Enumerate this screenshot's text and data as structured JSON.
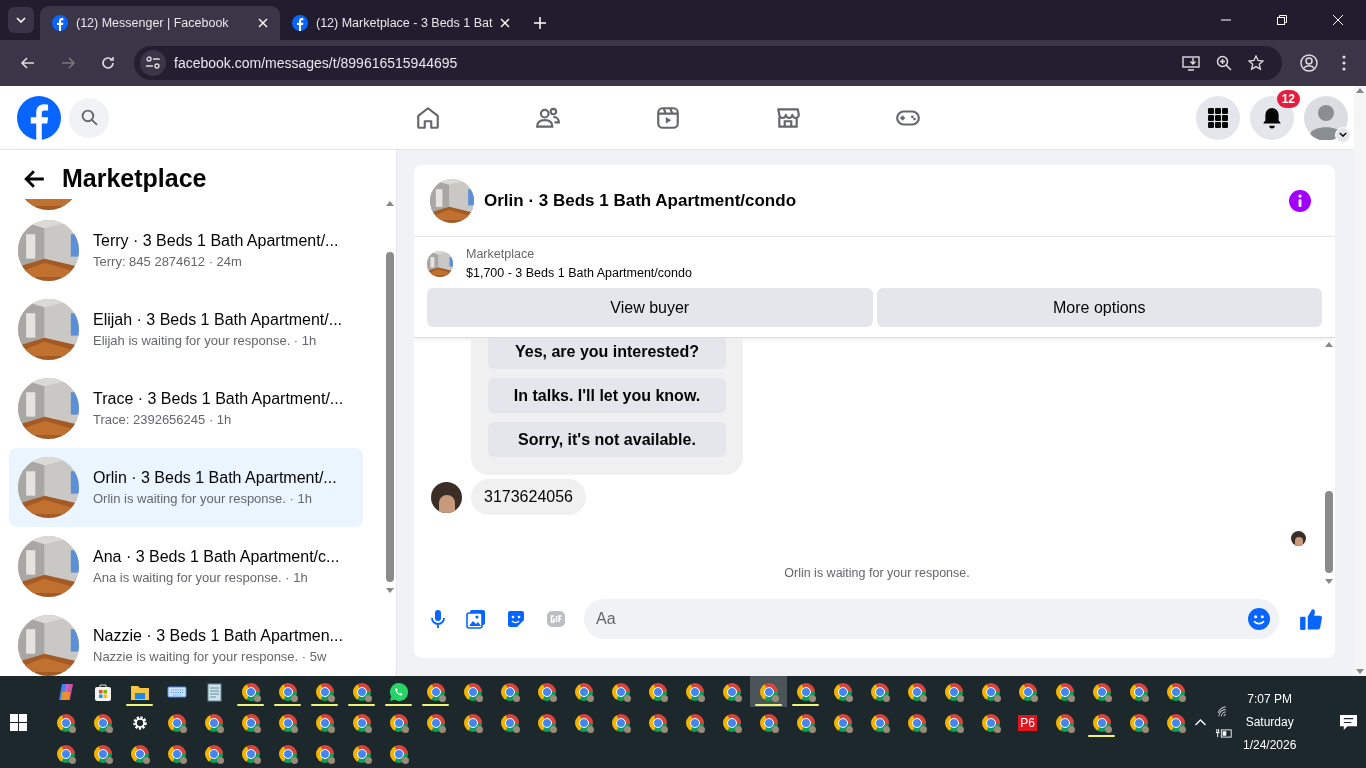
{
  "browser": {
    "tabs": [
      {
        "title": "(12) Messenger | Facebook",
        "selected": true
      },
      {
        "title": "(12) Marketplace - 3 Beds 1 Bat",
        "selected": false
      }
    ],
    "url": "facebook.com/messages/t/899616515944695"
  },
  "header": {
    "notification_count": "12"
  },
  "sidebar": {
    "title": "Marketplace",
    "conversations": [
      {
        "title": "Terry · 3 Beds 1 Bath Apartment/...",
        "subtitle": "Terry: 845 2874612 · 24m",
        "selected": false
      },
      {
        "title": "Elijah · 3 Beds 1 Bath Apartment/...",
        "subtitle": "Elijah is waiting for your response. · 1h",
        "selected": false
      },
      {
        "title": "Trace · 3 Beds 1 Bath Apartment/...",
        "subtitle": "Trace: 2392656245 · 1h",
        "selected": false
      },
      {
        "title": "Orlin · 3 Beds 1 Bath Apartment/...",
        "subtitle": "Orlin is waiting for your response. · 1h",
        "selected": true
      },
      {
        "title": "Ana · 3 Beds 1 Bath Apartment/c...",
        "subtitle": "Ana is waiting for your response. · 1h",
        "selected": false
      },
      {
        "title": "Nazzie · 3 Beds 1 Bath Apartmen...",
        "subtitle": "Nazzie is waiting for your response. · 5w",
        "selected": false
      }
    ]
  },
  "chat": {
    "title": "Orlin · 3 Beds 1 Bath Apartment/condo",
    "listing_label": "Marketplace",
    "listing": "$1,700 - 3 Beds 1 Bath Apartment/condo",
    "buttons": [
      "View buyer",
      "More options"
    ],
    "quick_replies": [
      "Yes, are you interested?",
      "In talks. I'll let you know.",
      "Sorry, it's not available."
    ],
    "message": "3173624056",
    "status": "Orlin is waiting for your response.",
    "composer": {
      "placeholder": "Aa"
    }
  },
  "taskbar": {
    "rows": [
      [
        {
          "kind": "copilot",
          "running": false,
          "selected": false
        },
        {
          "kind": "store",
          "running": false,
          "selected": false
        },
        {
          "kind": "explorer",
          "running": true,
          "selected": false
        },
        {
          "kind": "keyboard",
          "running": false,
          "selected": false
        },
        {
          "kind": "notepad",
          "running": false,
          "selected": false
        },
        {
          "kind": "chrome",
          "running": true,
          "selected": false
        },
        {
          "kind": "chrome",
          "running": true,
          "selected": false
        },
        {
          "kind": "chrome",
          "running": true,
          "selected": false
        },
        {
          "kind": "chrome",
          "running": true,
          "selected": false
        },
        {
          "kind": "whatsapp",
          "running": true,
          "selected": false
        },
        {
          "kind": "chrome",
          "running": true,
          "selected": false
        },
        {
          "kind": "chrome",
          "running": false,
          "selected": false
        },
        {
          "kind": "chrome",
          "running": false,
          "selected": false
        },
        {
          "kind": "chrome",
          "running": false,
          "selected": false
        },
        {
          "kind": "chrome",
          "running": false,
          "selected": false
        },
        {
          "kind": "chrome",
          "running": false,
          "selected": false
        },
        {
          "kind": "chrome",
          "running": false,
          "selected": false
        },
        {
          "kind": "chrome",
          "running": false,
          "selected": false
        },
        {
          "kind": "chrome",
          "running": false,
          "selected": false
        },
        {
          "kind": "chrome",
          "running": true,
          "selected": true
        },
        {
          "kind": "chrome",
          "running": true,
          "selected": false
        },
        {
          "kind": "chrome",
          "running": false,
          "selected": false
        },
        {
          "kind": "chrome",
          "running": false,
          "selected": false
        },
        {
          "kind": "chrome",
          "running": false,
          "selected": false
        },
        {
          "kind": "chrome",
          "running": false,
          "selected": false
        },
        {
          "kind": "chrome",
          "running": false,
          "selected": false
        },
        {
          "kind": "chrome",
          "running": false,
          "selected": false
        },
        {
          "kind": "chrome",
          "running": false,
          "selected": false
        },
        {
          "kind": "chrome",
          "running": false,
          "selected": false
        },
        {
          "kind": "chrome",
          "running": false,
          "selected": false
        },
        {
          "kind": "chrome",
          "running": false,
          "selected": false
        }
      ],
      [
        {
          "kind": "chrome",
          "running": false,
          "selected": false
        },
        {
          "kind": "chrome",
          "running": false,
          "selected": false
        },
        {
          "kind": "settings",
          "running": false,
          "selected": false
        },
        {
          "kind": "chrome",
          "running": false,
          "selected": false
        },
        {
          "kind": "chrome",
          "running": false,
          "selected": false
        },
        {
          "kind": "chrome",
          "running": false,
          "selected": false
        },
        {
          "kind": "chrome",
          "running": false,
          "selected": false
        },
        {
          "kind": "chrome",
          "running": false,
          "selected": false
        },
        {
          "kind": "chrome",
          "running": false,
          "selected": false
        },
        {
          "kind": "chrome",
          "running": false,
          "selected": false
        },
        {
          "kind": "chrome",
          "running": false,
          "selected": false
        },
        {
          "kind": "chrome",
          "running": false,
          "selected": false
        },
        {
          "kind": "chrome",
          "running": false,
          "selected": false
        },
        {
          "kind": "chrome",
          "running": false,
          "selected": false
        },
        {
          "kind": "chrome",
          "running": false,
          "selected": false
        },
        {
          "kind": "chrome",
          "running": false,
          "selected": false
        },
        {
          "kind": "chrome",
          "running": false,
          "selected": false
        },
        {
          "kind": "chrome",
          "running": false,
          "selected": false
        },
        {
          "kind": "chrome",
          "running": false,
          "selected": false
        },
        {
          "kind": "chrome",
          "running": false,
          "selected": false
        },
        {
          "kind": "chrome",
          "running": false,
          "selected": false
        },
        {
          "kind": "chrome",
          "running": false,
          "selected": false
        },
        {
          "kind": "chrome",
          "running": false,
          "selected": false
        },
        {
          "kind": "chrome",
          "running": false,
          "selected": false
        },
        {
          "kind": "chrome",
          "running": false,
          "selected": false
        },
        {
          "kind": "chrome",
          "running": false,
          "selected": false
        },
        {
          "kind": "text",
          "label": "P6",
          "running": false,
          "selected": false
        },
        {
          "kind": "chrome",
          "running": false,
          "selected": false
        },
        {
          "kind": "chrome",
          "running": true,
          "selected": false
        },
        {
          "kind": "chrome",
          "running": false,
          "selected": false
        },
        {
          "kind": "chrome",
          "running": false,
          "selected": false
        }
      ],
      [
        {
          "kind": "chrome",
          "running": false,
          "selected": false
        },
        {
          "kind": "chrome",
          "running": false,
          "selected": false
        },
        {
          "kind": "chrome",
          "running": false,
          "selected": false
        },
        {
          "kind": "chrome",
          "running": false,
          "selected": false
        },
        {
          "kind": "chrome",
          "running": false,
          "selected": false
        },
        {
          "kind": "chrome",
          "running": false,
          "selected": false
        },
        {
          "kind": "chrome",
          "running": false,
          "selected": false
        },
        {
          "kind": "chrome",
          "running": false,
          "selected": false
        },
        {
          "kind": "chrome",
          "running": false,
          "selected": false
        },
        {
          "kind": "chrome",
          "running": false,
          "selected": false
        }
      ]
    ],
    "time": "7:07 PM",
    "day": "Saturday",
    "date": "1/24/2026"
  }
}
